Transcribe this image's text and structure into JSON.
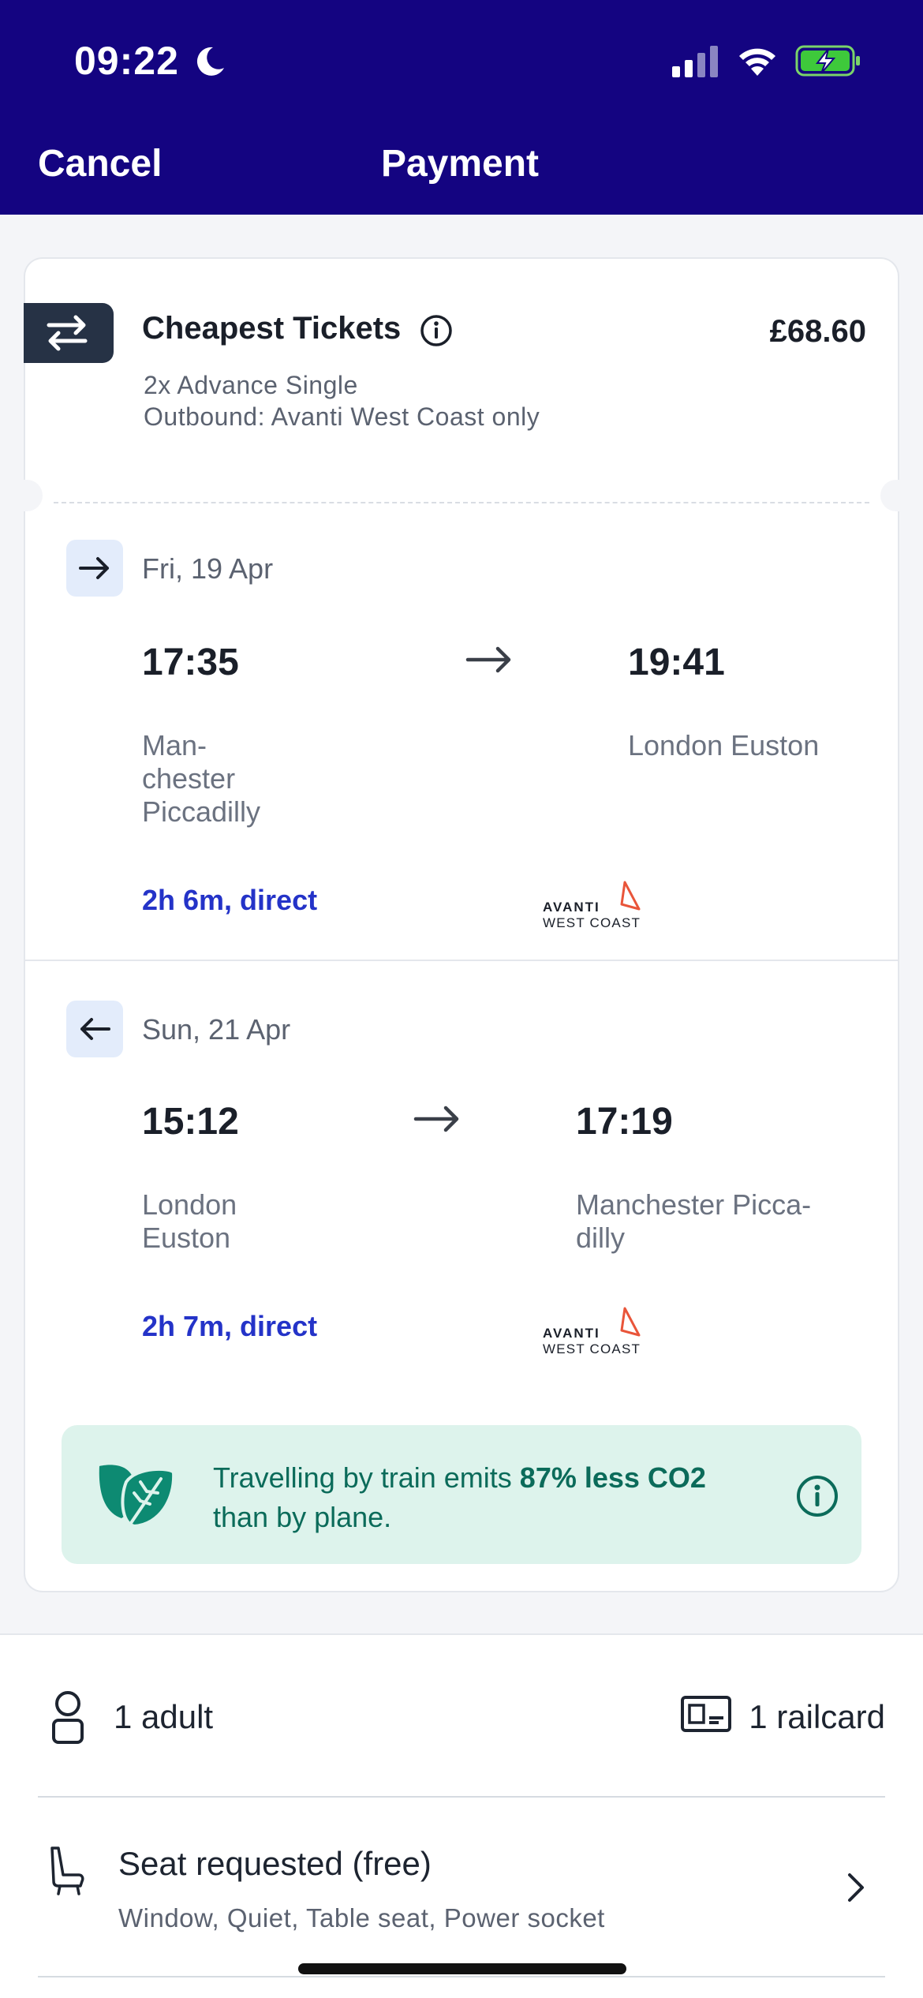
{
  "status_bar": {
    "time": "09:22",
    "moon_icon": "moon-icon",
    "signal_icon": "cellular-signal-icon",
    "wifi_icon": "wifi-icon",
    "battery_icon": "battery-charging-icon"
  },
  "nav": {
    "cancel_label": "Cancel",
    "title": "Payment",
    "background": "#140481"
  },
  "ticket": {
    "title": "Cheapest Tickets",
    "price": "£68.60",
    "line1": "2x Advance Single",
    "line2": "Outbound: Avanti West Coast only"
  },
  "legs": [
    {
      "direction_icon": "arrow-right-icon",
      "date": "Fri, 19 Apr",
      "depart_time": "17:35",
      "arrive_time": "19:41",
      "from_lines": [
        "Man-",
        "chester",
        "Piccadilly"
      ],
      "to_lines": [
        "London Euston"
      ],
      "duration": "2h 6m, direct",
      "operator_line1": "AVANTI",
      "operator_line2": "WEST COAST"
    },
    {
      "direction_icon": "arrow-left-icon",
      "date": "Sun, 21 Apr",
      "depart_time": "15:12",
      "arrive_time": "17:19",
      "from_lines": [
        "London",
        "Euston"
      ],
      "to_lines": [
        "Manchester Picca-",
        "dilly"
      ],
      "duration": "2h 7m, direct",
      "operator_line1": "AVANTI",
      "operator_line2": "WEST COAST"
    }
  ],
  "eco": {
    "text_a": "Travelling by train emits ",
    "text_bold": "87% less CO2",
    "text_b": " than by plane.",
    "icon": "leaf-icon",
    "color": "#0b6b5a"
  },
  "passengers": {
    "adults": "1 adult",
    "railcards": "1 railcard"
  },
  "seat": {
    "title": "Seat requested (free)",
    "options": "Window, Quiet, Table seat, Power socket"
  }
}
